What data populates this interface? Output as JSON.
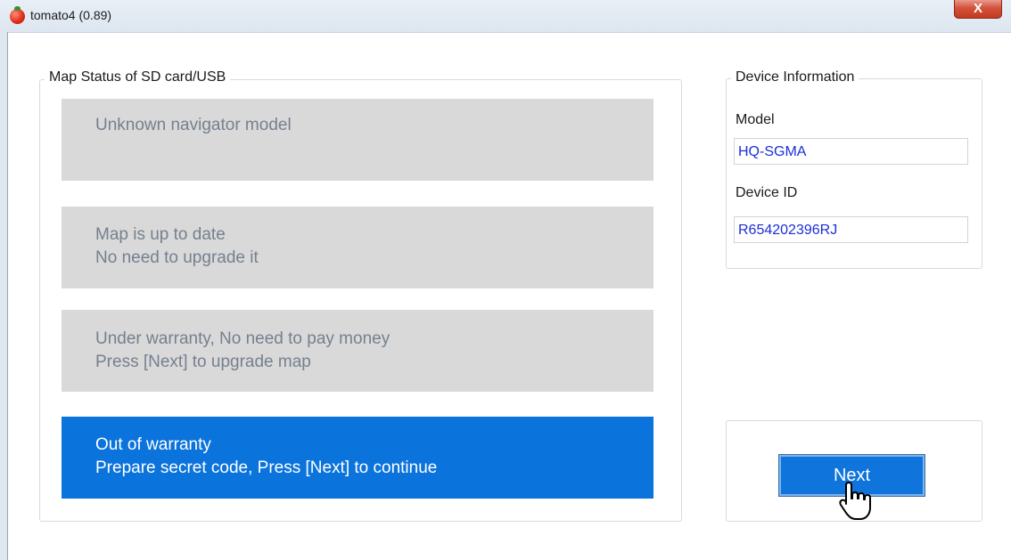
{
  "window": {
    "title": "tomato4 (0.89)",
    "close_label": "X"
  },
  "map_status": {
    "title": "Map Status of SD card/USB",
    "items": [
      {
        "lines": [
          "Unknown navigator model"
        ],
        "active": false
      },
      {
        "lines": [
          "Map is up to date",
          "No need to upgrade it"
        ],
        "active": false
      },
      {
        "lines": [
          "Under warranty, No need to pay money",
          "Press [Next] to upgrade map"
        ],
        "active": false
      },
      {
        "lines": [
          "Out of warranty",
          "Prepare secret code, Press [Next] to continue"
        ],
        "active": true
      }
    ]
  },
  "device_info": {
    "title": "Device Information",
    "model_label": "Model",
    "model_value": "HQ-SGMA",
    "device_id_label": "Device ID",
    "device_id_value": "R654202396RJ"
  },
  "actions": {
    "next_label": "Next"
  },
  "icons": {
    "app": "tomato-icon",
    "close": "close-icon",
    "cursor": "hand-pointer-icon"
  },
  "colors": {
    "active_status": "#0b73dc",
    "inactive_status": "#d9d9d9",
    "inactive_text": "#76808e",
    "field_text": "#1c2ed8",
    "next_button": "#0f75dd"
  }
}
